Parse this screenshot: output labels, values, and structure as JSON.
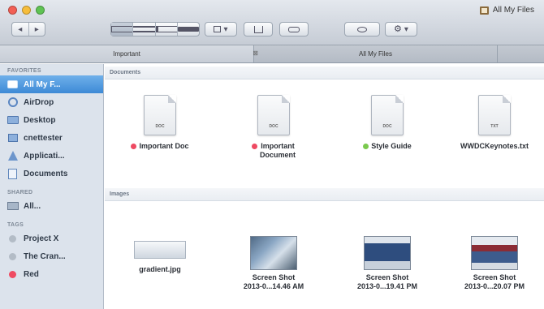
{
  "window": {
    "title": "All My Files"
  },
  "toolbar": {
    "view_buttons": [
      "icon-view",
      "list-view",
      "column-view",
      "coverflow-view"
    ],
    "arrange_label": "▾",
    "action_label": "▾"
  },
  "tabs": [
    {
      "label": "Important",
      "active": true
    },
    {
      "label": "All My Files",
      "active": false
    }
  ],
  "sidebar": {
    "favorites_header": "FAVORITES",
    "favorites": [
      {
        "label": "All My F...",
        "icon": "all-files-icon",
        "selected": true
      },
      {
        "label": "AirDrop",
        "icon": "airdrop-icon"
      },
      {
        "label": "Desktop",
        "icon": "desktop-icon"
      },
      {
        "label": "cnettester",
        "icon": "home-icon"
      },
      {
        "label": "Applicati...",
        "icon": "applications-icon"
      },
      {
        "label": "Documents",
        "icon": "documents-icon"
      }
    ],
    "shared_header": "SHARED",
    "shared": [
      {
        "label": "All...",
        "icon": "shared-computer-icon"
      }
    ],
    "tags_header": "TAGS",
    "tags": [
      {
        "label": "Project X",
        "color": "#b3bcc6"
      },
      {
        "label": "The Cran...",
        "color": "#b3bcc6"
      },
      {
        "label": "Red",
        "color": "#ef4b62"
      }
    ]
  },
  "content": {
    "documents_header": "Documents",
    "documents": [
      {
        "name": "Important Doc",
        "name2": "",
        "ext": "DOC",
        "tag_color": "#ee4a62"
      },
      {
        "name": "Important",
        "name2": "Document",
        "ext": "DOC",
        "tag_color": "#ee4a62"
      },
      {
        "name": "Style Guide",
        "name2": "",
        "ext": "DOC",
        "tag_color": "#7ac94e"
      },
      {
        "name": "WWDCKeynotes.txt",
        "name2": "",
        "ext": "TXT",
        "tag_color": ""
      }
    ],
    "images_header": "Images",
    "images": [
      {
        "name": "gradient.jpg",
        "name2": ""
      },
      {
        "name": "Screen Shot",
        "name2": "2013-0...14.46 AM"
      },
      {
        "name": "Screen Shot",
        "name2": "2013-0...19.41 PM"
      },
      {
        "name": "Screen Shot",
        "name2": "2013-0...20.07 PM"
      }
    ]
  }
}
